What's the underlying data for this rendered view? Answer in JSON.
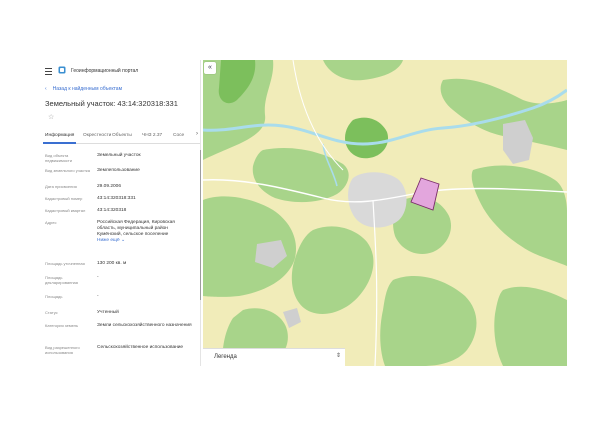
{
  "header": {
    "app_title": "Геоинформационный портал"
  },
  "navigation": {
    "back_label": "Назад к найденным объектам"
  },
  "object": {
    "title": "Земельный участок: 43:14:320318:331"
  },
  "tabs": [
    {
      "label": "Информация",
      "active": true
    },
    {
      "label": "Окрестности",
      "active": false
    },
    {
      "label": "Объекты",
      "active": false
    },
    {
      "label": "ЧНЗ 2.37",
      "active": false
    },
    {
      "label": "Сосе",
      "active": false
    }
  ],
  "properties": [
    {
      "key": "Вид объекта недвижимости",
      "value": "Земельный участок"
    },
    {
      "key": "Вид земельного участка",
      "value": "Землепользование"
    },
    {
      "key": "Дата присвоения",
      "value": "29.09.2006"
    },
    {
      "key": "Кадастровый номер",
      "value": "43:14:320318:331"
    },
    {
      "key": "Кадастровый квартал",
      "value": "43:14:320318"
    },
    {
      "key": "Адрес",
      "value": "Российская Федерация, Кировская область, муниципальный район Кумёнский, сельское поселение",
      "more": "Ниже ещё"
    },
    {
      "key": "Площадь уточненная",
      "value": "130 200 кв. м"
    },
    {
      "key": "Площадь декларированная",
      "value": "-"
    },
    {
      "key": "Площадь",
      "value": "-"
    },
    {
      "key": "Статус",
      "value": "Учтенный"
    },
    {
      "key": "Категория земель",
      "value": "Земли сельскохозяйственного назначения"
    },
    {
      "key": "Вид разрешенного использования",
      "value": "Сельскохозяйственное использование"
    }
  ],
  "map": {
    "collapse_icon": "double-chevron-left-icon",
    "legend_label": "Легенда",
    "colors": {
      "field": "#f1ecb9",
      "forest": "#a8d48a",
      "forest_dark": "#7cbf5c",
      "river": "#a9dcec",
      "urban": "#d9d9d9",
      "parcel_fill": "#e3a6dd",
      "parcel_stroke": "#7a2d6a",
      "road": "#ffffff"
    }
  }
}
